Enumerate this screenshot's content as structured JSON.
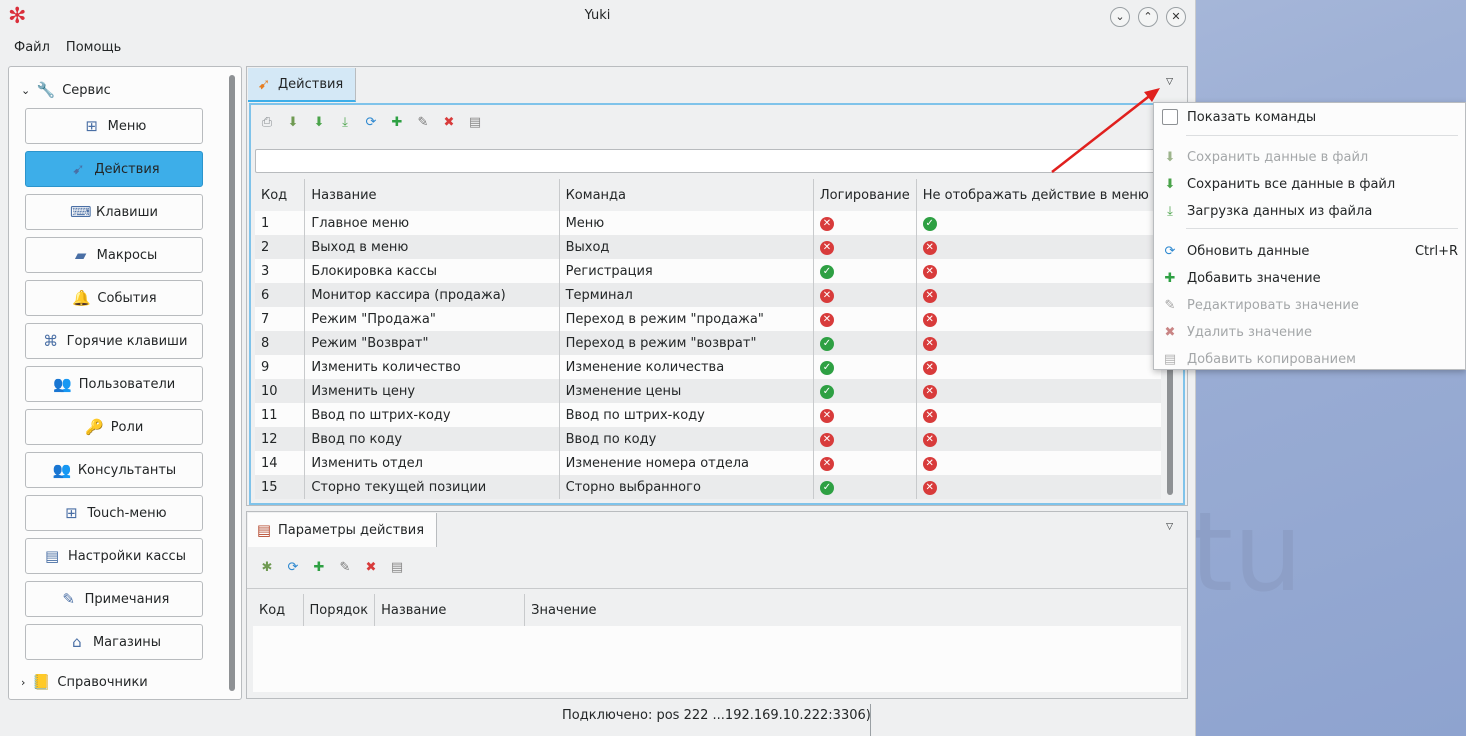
{
  "window": {
    "title": "Yuki"
  },
  "background_text": "tu",
  "menubar": [
    "Файл",
    "Помощь"
  ],
  "sidebar": {
    "categories": [
      {
        "label": "Сервис",
        "icon": "wrench-icon",
        "expanded": true
      },
      {
        "label": "Справочники",
        "icon": "book-icon",
        "expanded": false
      }
    ],
    "buttons": [
      {
        "label": "Меню",
        "icon": "menu-tree-icon",
        "glyph": "⊞"
      },
      {
        "label": "Действия",
        "icon": "actions-icon",
        "glyph": "➹",
        "active": true
      },
      {
        "label": "Клавиши",
        "icon": "keys-icon",
        "glyph": "⌨"
      },
      {
        "label": "Макросы",
        "icon": "macros-icon",
        "glyph": "▰"
      },
      {
        "label": "События",
        "icon": "bell-icon",
        "glyph": "🔔"
      },
      {
        "label": "Горячие клавиши",
        "icon": "hotkeys-icon",
        "glyph": "⌘"
      },
      {
        "label": "Пользователи",
        "icon": "users-icon",
        "glyph": "👥"
      },
      {
        "label": "Роли",
        "icon": "key-icon",
        "glyph": "🔑"
      },
      {
        "label": "Консультанты",
        "icon": "consultants-icon",
        "glyph": "👥"
      },
      {
        "label": "Touch-меню",
        "icon": "touch-menu-icon",
        "glyph": "⊞"
      },
      {
        "label": "Настройки кассы",
        "icon": "register-settings-icon",
        "glyph": "▤"
      },
      {
        "label": "Примечания",
        "icon": "notes-icon",
        "glyph": "✎"
      },
      {
        "label": "Магазины",
        "icon": "store-icon",
        "glyph": "⌂"
      }
    ]
  },
  "actions_panel": {
    "tab_label": "Действия",
    "filter_value": "",
    "columns": [
      "Код",
      "Название",
      "Команда",
      "Логирование",
      "Не отображать действие в меню «С"
    ],
    "rows": [
      {
        "code": "1",
        "name": "Главное меню",
        "command": "Меню",
        "log": false,
        "hide": true
      },
      {
        "code": "2",
        "name": "Выход в меню",
        "command": "Выход",
        "log": false,
        "hide": false
      },
      {
        "code": "3",
        "name": "Блокировка кассы",
        "command": "Регистрация",
        "log": true,
        "hide": false
      },
      {
        "code": "6",
        "name": "Монитор кассира (продажа)",
        "command": "Терминал",
        "log": false,
        "hide": false
      },
      {
        "code": "7",
        "name": "Режим \"Продажа\"",
        "command": "Переход в режим \"продажа\"",
        "log": false,
        "hide": false
      },
      {
        "code": "8",
        "name": "Режим \"Возврат\"",
        "command": "Переход в режим \"возврат\"",
        "log": true,
        "hide": false
      },
      {
        "code": "9",
        "name": "Изменить количество",
        "command": "Изменение количества",
        "log": true,
        "hide": false
      },
      {
        "code": "10",
        "name": "Изменить цену",
        "command": "Изменение цены",
        "log": true,
        "hide": false
      },
      {
        "code": "11",
        "name": "Ввод по штрих-коду",
        "command": "Ввод по штрих-коду",
        "log": false,
        "hide": false
      },
      {
        "code": "12",
        "name": "Ввод по коду",
        "command": "Ввод по коду",
        "log": false,
        "hide": false
      },
      {
        "code": "14",
        "name": "Изменить отдел",
        "command": "Изменение номера отдела",
        "log": false,
        "hide": false
      },
      {
        "code": "15",
        "name": "Сторно текущей позиции",
        "command": "Сторно выбранного",
        "log": true,
        "hide": false
      }
    ]
  },
  "params_panel": {
    "tab_label": "Параметры действия",
    "columns": [
      "Код",
      "Порядок",
      "Название",
      "Значение"
    ]
  },
  "context_menu": {
    "show_commands": "Показать команды",
    "items": [
      {
        "label": "Сохранить данные в файл",
        "icon": "save-file-icon",
        "disabled": true
      },
      {
        "label": "Сохранить все данные в файл",
        "icon": "save-all-icon",
        "disabled": false
      },
      {
        "label": "Загрузка данных из файла",
        "icon": "load-file-icon",
        "disabled": false
      },
      {
        "label": "Обновить данные",
        "icon": "refresh-icon",
        "shortcut": "Ctrl+R",
        "disabled": false
      },
      {
        "label": "Добавить значение",
        "icon": "add-icon",
        "disabled": false
      },
      {
        "label": "Редактировать значение",
        "icon": "edit-icon",
        "disabled": true
      },
      {
        "label": "Удалить значение",
        "icon": "delete-icon",
        "disabled": true
      },
      {
        "label": "Добавить копированием",
        "icon": "copy-icon",
        "disabled": true
      }
    ]
  },
  "status": {
    "text": "Подключено: pos 222 ...192.169.10.222:3306)"
  },
  "colors": {
    "accent": "#3daee9",
    "error": "#d83b3b",
    "ok": "#2ea043",
    "arrow": "#e0201e"
  }
}
